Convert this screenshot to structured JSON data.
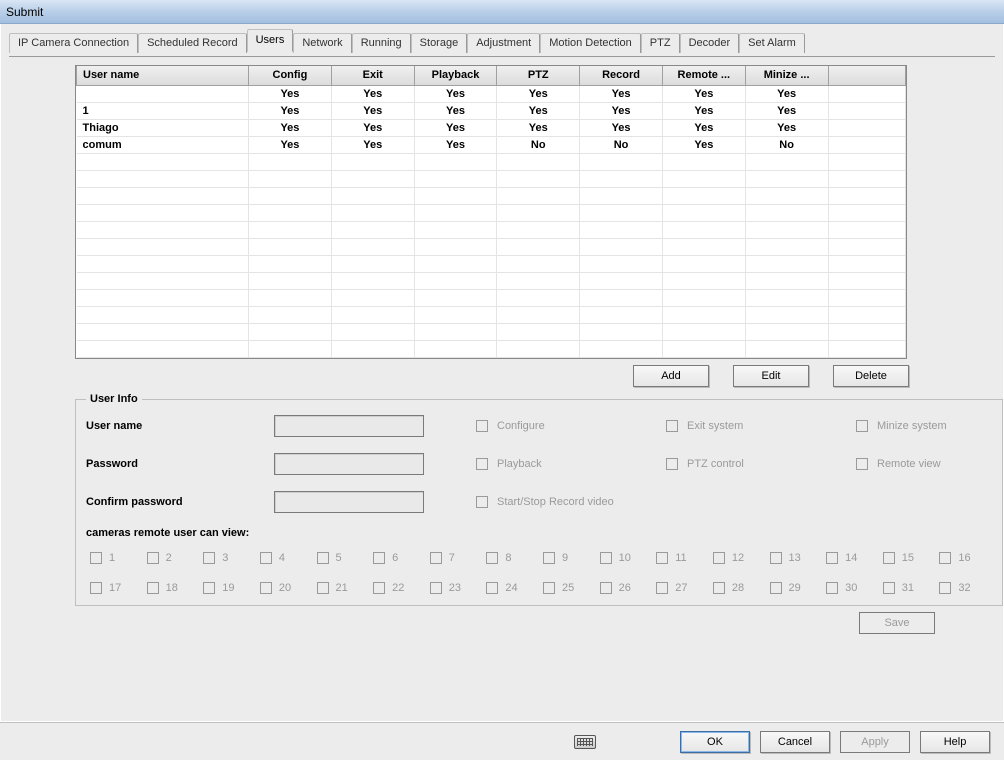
{
  "window": {
    "title": "Submit"
  },
  "tabs": [
    {
      "label": "IP Camera Connection"
    },
    {
      "label": "Scheduled Record"
    },
    {
      "label": "Users",
      "active": true
    },
    {
      "label": "Network"
    },
    {
      "label": "Running"
    },
    {
      "label": "Storage"
    },
    {
      "label": "Adjustment"
    },
    {
      "label": "Motion Detection"
    },
    {
      "label": "PTZ"
    },
    {
      "label": "Decoder"
    },
    {
      "label": "Set Alarm"
    }
  ],
  "users_table": {
    "columns": [
      "User name",
      "Config",
      "Exit",
      "Playback",
      "PTZ",
      "Record",
      "Remote ...",
      "Minize ..."
    ],
    "rows": [
      {
        "name": "",
        "cells": [
          "Yes",
          "Yes",
          "Yes",
          "Yes",
          "Yes",
          "Yes",
          "Yes"
        ]
      },
      {
        "name": "1",
        "cells": [
          "Yes",
          "Yes",
          "Yes",
          "Yes",
          "Yes",
          "Yes",
          "Yes"
        ]
      },
      {
        "name": "Thiago",
        "cells": [
          "Yes",
          "Yes",
          "Yes",
          "Yes",
          "Yes",
          "Yes",
          "Yes"
        ]
      },
      {
        "name": "comum",
        "cells": [
          "Yes",
          "Yes",
          "Yes",
          "No",
          "No",
          "Yes",
          "No"
        ]
      }
    ]
  },
  "actions": {
    "add": "Add",
    "edit": "Edit",
    "delete": "Delete",
    "save": "Save"
  },
  "userinfo": {
    "legend": "User Info",
    "labels": {
      "username": "User name",
      "password": "Password",
      "confirm": "Confirm password",
      "cameras": "cameras remote user can view:"
    },
    "permissions": {
      "configure": "Configure",
      "exit": "Exit system",
      "minimize": "Minize system",
      "playback": "Playback",
      "ptz": "PTZ control",
      "remote": "Remote view",
      "record": "Start/Stop  Record video"
    },
    "cameras": [
      "1",
      "2",
      "3",
      "4",
      "5",
      "6",
      "7",
      "8",
      "9",
      "10",
      "11",
      "12",
      "13",
      "14",
      "15",
      "16",
      "17",
      "18",
      "19",
      "20",
      "21",
      "22",
      "23",
      "24",
      "25",
      "26",
      "27",
      "28",
      "29",
      "30",
      "31",
      "32"
    ]
  },
  "bottom": {
    "ok": "OK",
    "cancel": "Cancel",
    "apply": "Apply",
    "help": "Help"
  }
}
